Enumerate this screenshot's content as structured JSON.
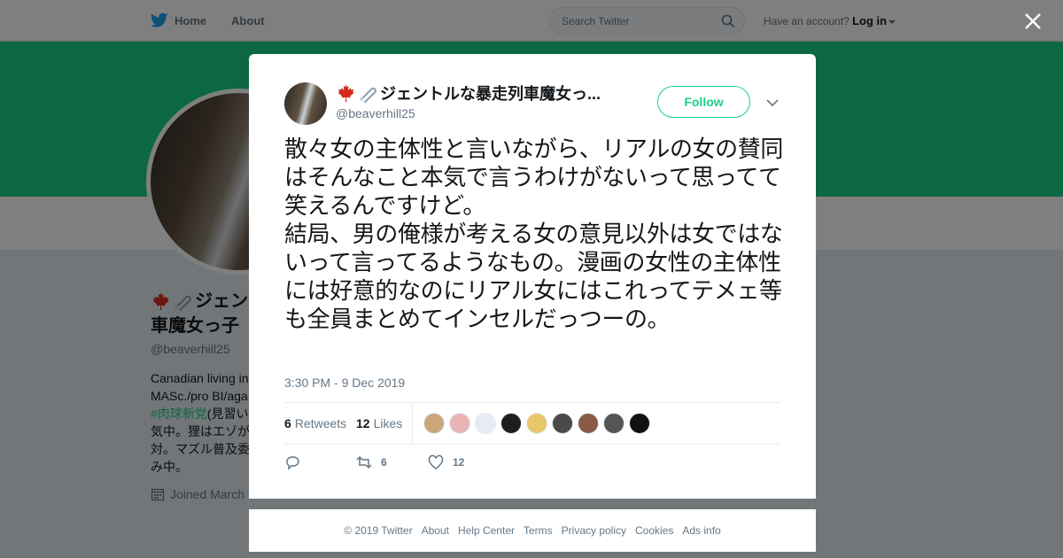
{
  "nav": {
    "home_label": "Home",
    "about_label": "About",
    "search_placeholder": "Search Twitter",
    "account_prompt": "Have an account?",
    "login_label": "Log in"
  },
  "background_profile": {
    "name_line1": "ジェン",
    "name_line2": "車魔女っ子",
    "handle": "@beaverhill25",
    "bio_line1": "Canadian living in",
    "bio_line2": "MASc./pro BI/aga",
    "bio_hashtag": "#肉球新党",
    "bio_line3_rest": "(見習い",
    "bio_line4": "気中。狸はエゾが",
    "bio_line5": "対。マズル普及委",
    "bio_line6": "み中。",
    "joined": "Joined March"
  },
  "tweet": {
    "display_name": "ジェントルな暴走列車魔女っ...",
    "handle": "@beaverhill25",
    "follow_label": "Follow",
    "text": "散々女の主体性と言いながら、リアルの女の賛同はそんなこと本気で言うわけがないって思ってて笑えるんですけど。\n結局、男の俺様が考える女の意見以外は女ではないって言ってるようなもの。漫画の女性の主体性には好意的なのにリアル女にはこれってテメェ等も全員まとめてインセルだっつーの。",
    "timestamp": "3:30 PM - 9 Dec 2019",
    "retweets_count": "6",
    "retweets_label": "Retweets",
    "likes_count": "12",
    "likes_label": "Likes",
    "reply_count": "",
    "retweet_action_count": "6",
    "like_action_count": "12"
  },
  "likers": [
    {
      "color": "#c9a77a"
    },
    {
      "color": "#e8b4b4"
    },
    {
      "color": "#e6ecf5"
    },
    {
      "color": "#1e1e1e"
    },
    {
      "color": "#e8c66a"
    },
    {
      "color": "#4a4a4a"
    },
    {
      "color": "#8a5a44"
    },
    {
      "color": "#555555"
    },
    {
      "color": "#111111"
    }
  ],
  "colors": {
    "accent": "#19cf86",
    "twitter_blue": "#1da1f2"
  },
  "footer": {
    "links": [
      "© 2019 Twitter",
      "About",
      "Help Center",
      "Terms",
      "Privacy policy",
      "Cookies",
      "Ads info"
    ]
  }
}
